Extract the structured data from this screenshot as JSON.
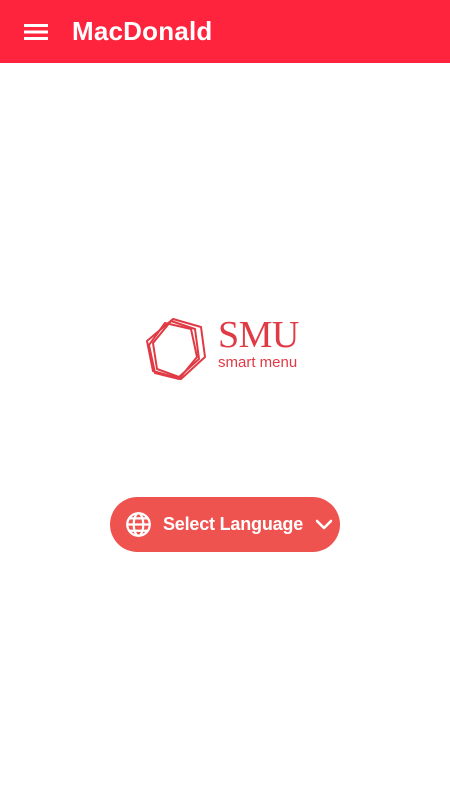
{
  "appbar": {
    "title": "MacDonald",
    "menu_icon": "menu-icon",
    "color": "#ff243d"
  },
  "logo": {
    "brand": "SMU",
    "tagline": "smart menu",
    "color": "#e03a45"
  },
  "language_button": {
    "label": "Select Language",
    "icon": "globe-icon",
    "dropdown_icon": "chevron-down-icon",
    "color": "#ef5350"
  }
}
